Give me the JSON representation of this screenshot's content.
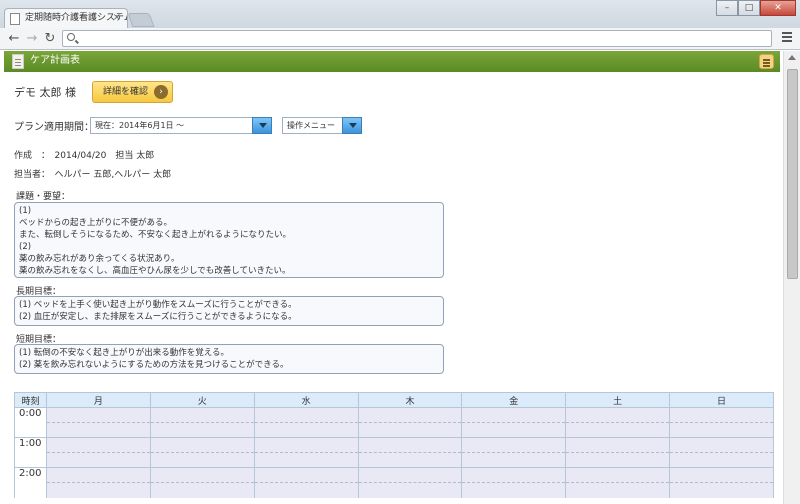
{
  "browser": {
    "tab_title": "定期随時介護看護システム",
    "tab_close": "×",
    "url": ""
  },
  "app": {
    "header_title": "ケア計画表",
    "patient_name": "デモ 太郎 様",
    "detail_button": "詳細を確認",
    "plan_period_label": "プラン適用期間：",
    "plan_period_value": "現在：2014年6月1日 ～",
    "ops_menu_value": "操作メニュー",
    "created_line": "作成　：　2014/04/20　担当 太郎",
    "staff_line": "担当者：　ヘルパー 五郎,ヘルパー 太郎"
  },
  "sections": {
    "issues": {
      "label": "課題・要望：",
      "lines": [
        "(1)",
        "ベッドからの起き上がりに不便がある。",
        "また、転倒しそうになるため、不安なく起き上がれるようになりたい。",
        "(2)",
        "薬の飲み忘れがあり余ってくる状況あり。",
        "薬の飲み忘れをなくし、高血圧やひん尿を少しでも改善していきたい。"
      ]
    },
    "long_term": {
      "label": "長期目標：",
      "lines": [
        "(1) ベッドを上手く使い起き上がり動作をスムーズに行うことができる。",
        "(2) 血圧が安定し、また排尿をスムーズに行うことができるようになる。"
      ]
    },
    "short_term": {
      "label": "短期目標：",
      "lines": [
        "(1) 転倒の不安なく起き上がりが出来る動作を覚える。",
        "(2) 薬を飲み忘れないようにするための方法を見つけることができる。"
      ]
    }
  },
  "schedule": {
    "time_header": "時刻",
    "days": [
      "月",
      "火",
      "水",
      "木",
      "金",
      "土",
      "日"
    ],
    "times": [
      "0:00",
      "1:00",
      "2:00"
    ]
  },
  "colors": {
    "header_green": "#5b8a24",
    "accent_yellow": "#f6c83e",
    "dropdown_blue": "#3c93dc"
  }
}
